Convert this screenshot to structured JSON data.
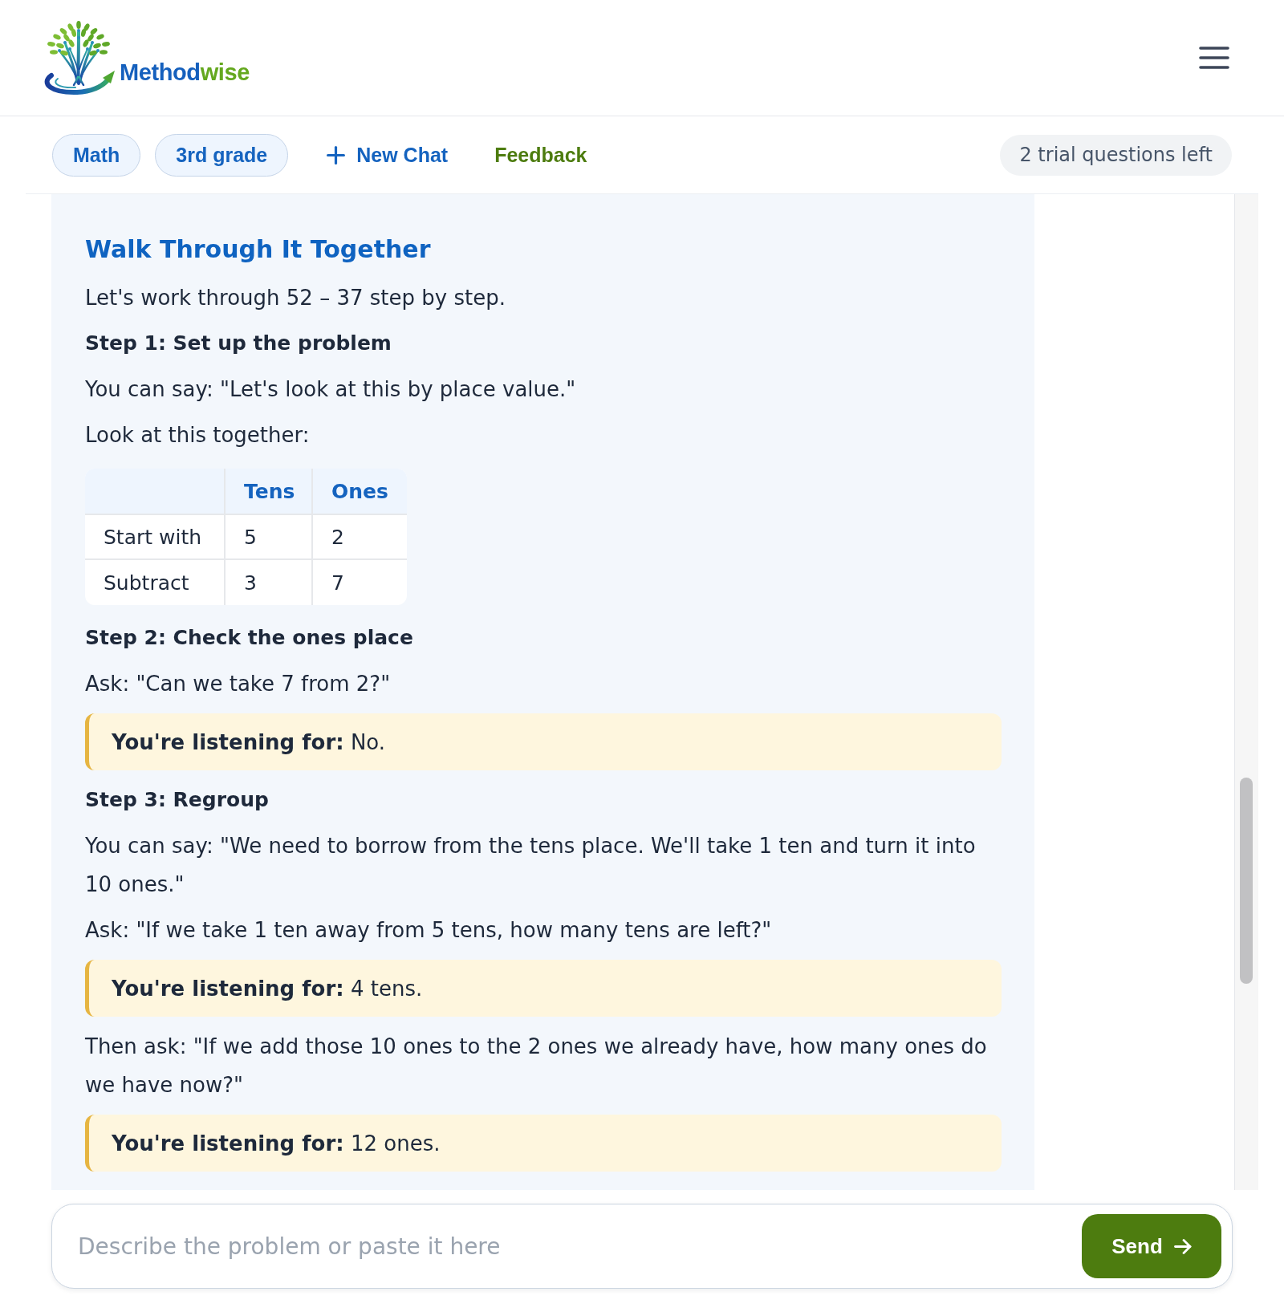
{
  "header": {
    "brand": {
      "first": "Method",
      "second": "wise"
    }
  },
  "toolbar": {
    "chips": [
      {
        "label": "Math"
      },
      {
        "label": "3rd grade"
      }
    ],
    "new_chat": "New Chat",
    "feedback": "Feedback",
    "trial_badge": "2 trial questions left"
  },
  "message": {
    "title": "Walk Through It Together",
    "blocks": [
      {
        "kind": "paragraph",
        "text": "Let's work through 52 – 37 step by step."
      },
      {
        "kind": "step",
        "text": "Step 1: Set up the problem"
      },
      {
        "kind": "paragraph",
        "text": "You can say: \"Let's look at this by place value.\""
      },
      {
        "kind": "paragraph",
        "text": "Look at this together:"
      },
      {
        "kind": "table",
        "columns": [
          "Tens",
          "Ones"
        ],
        "rows": [
          {
            "label": "Start with",
            "cells": [
              "5",
              "2"
            ]
          },
          {
            "label": "Subtract",
            "cells": [
              "3",
              "7"
            ]
          }
        ]
      },
      {
        "kind": "step",
        "text": "Step 2: Check the ones place"
      },
      {
        "kind": "paragraph",
        "text": "Ask: \"Can we take 7 from 2?\""
      },
      {
        "kind": "callout",
        "text": "**You're listening for:** No."
      },
      {
        "kind": "step",
        "text": "Step 3: Regroup"
      },
      {
        "kind": "paragraph",
        "text": "You can say: \"We need to borrow from the tens place. We'll take 1 ten and turn it into 10 ones.\""
      },
      {
        "kind": "paragraph",
        "text": "Ask: \"If we take 1 ten away from 5 tens, how many tens are left?\""
      },
      {
        "kind": "callout",
        "text": "**You're listening for:** 4 tens."
      },
      {
        "kind": "paragraph",
        "text": "Then ask: \"If we add those 10 ones to the 2 ones we already have, how many ones do we have now?\""
      },
      {
        "kind": "callout",
        "text": "**You're listening for:** 12 ones."
      }
    ]
  },
  "composer": {
    "placeholder": "Describe the problem or paste it here",
    "send": "Send"
  }
}
